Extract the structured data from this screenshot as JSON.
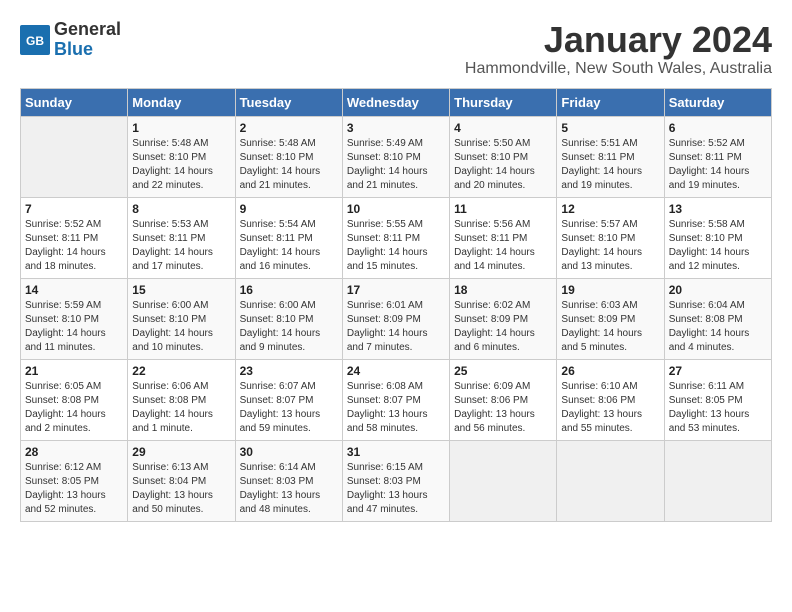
{
  "header": {
    "logo_general": "General",
    "logo_blue": "Blue",
    "title": "January 2024",
    "subtitle": "Hammondville, New South Wales, Australia"
  },
  "days_of_week": [
    "Sunday",
    "Monday",
    "Tuesday",
    "Wednesday",
    "Thursday",
    "Friday",
    "Saturday"
  ],
  "weeks": [
    [
      {
        "day": "",
        "info": ""
      },
      {
        "day": "1",
        "info": "Sunrise: 5:48 AM\nSunset: 8:10 PM\nDaylight: 14 hours\nand 22 minutes."
      },
      {
        "day": "2",
        "info": "Sunrise: 5:48 AM\nSunset: 8:10 PM\nDaylight: 14 hours\nand 21 minutes."
      },
      {
        "day": "3",
        "info": "Sunrise: 5:49 AM\nSunset: 8:10 PM\nDaylight: 14 hours\nand 21 minutes."
      },
      {
        "day": "4",
        "info": "Sunrise: 5:50 AM\nSunset: 8:10 PM\nDaylight: 14 hours\nand 20 minutes."
      },
      {
        "day": "5",
        "info": "Sunrise: 5:51 AM\nSunset: 8:11 PM\nDaylight: 14 hours\nand 19 minutes."
      },
      {
        "day": "6",
        "info": "Sunrise: 5:52 AM\nSunset: 8:11 PM\nDaylight: 14 hours\nand 19 minutes."
      }
    ],
    [
      {
        "day": "7",
        "info": "Sunrise: 5:52 AM\nSunset: 8:11 PM\nDaylight: 14 hours\nand 18 minutes."
      },
      {
        "day": "8",
        "info": "Sunrise: 5:53 AM\nSunset: 8:11 PM\nDaylight: 14 hours\nand 17 minutes."
      },
      {
        "day": "9",
        "info": "Sunrise: 5:54 AM\nSunset: 8:11 PM\nDaylight: 14 hours\nand 16 minutes."
      },
      {
        "day": "10",
        "info": "Sunrise: 5:55 AM\nSunset: 8:11 PM\nDaylight: 14 hours\nand 15 minutes."
      },
      {
        "day": "11",
        "info": "Sunrise: 5:56 AM\nSunset: 8:11 PM\nDaylight: 14 hours\nand 14 minutes."
      },
      {
        "day": "12",
        "info": "Sunrise: 5:57 AM\nSunset: 8:10 PM\nDaylight: 14 hours\nand 13 minutes."
      },
      {
        "day": "13",
        "info": "Sunrise: 5:58 AM\nSunset: 8:10 PM\nDaylight: 14 hours\nand 12 minutes."
      }
    ],
    [
      {
        "day": "14",
        "info": "Sunrise: 5:59 AM\nSunset: 8:10 PM\nDaylight: 14 hours\nand 11 minutes."
      },
      {
        "day": "15",
        "info": "Sunrise: 6:00 AM\nSunset: 8:10 PM\nDaylight: 14 hours\nand 10 minutes."
      },
      {
        "day": "16",
        "info": "Sunrise: 6:00 AM\nSunset: 8:10 PM\nDaylight: 14 hours\nand 9 minutes."
      },
      {
        "day": "17",
        "info": "Sunrise: 6:01 AM\nSunset: 8:09 PM\nDaylight: 14 hours\nand 7 minutes."
      },
      {
        "day": "18",
        "info": "Sunrise: 6:02 AM\nSunset: 8:09 PM\nDaylight: 14 hours\nand 6 minutes."
      },
      {
        "day": "19",
        "info": "Sunrise: 6:03 AM\nSunset: 8:09 PM\nDaylight: 14 hours\nand 5 minutes."
      },
      {
        "day": "20",
        "info": "Sunrise: 6:04 AM\nSunset: 8:08 PM\nDaylight: 14 hours\nand 4 minutes."
      }
    ],
    [
      {
        "day": "21",
        "info": "Sunrise: 6:05 AM\nSunset: 8:08 PM\nDaylight: 14 hours\nand 2 minutes."
      },
      {
        "day": "22",
        "info": "Sunrise: 6:06 AM\nSunset: 8:08 PM\nDaylight: 14 hours\nand 1 minute."
      },
      {
        "day": "23",
        "info": "Sunrise: 6:07 AM\nSunset: 8:07 PM\nDaylight: 13 hours\nand 59 minutes."
      },
      {
        "day": "24",
        "info": "Sunrise: 6:08 AM\nSunset: 8:07 PM\nDaylight: 13 hours\nand 58 minutes."
      },
      {
        "day": "25",
        "info": "Sunrise: 6:09 AM\nSunset: 8:06 PM\nDaylight: 13 hours\nand 56 minutes."
      },
      {
        "day": "26",
        "info": "Sunrise: 6:10 AM\nSunset: 8:06 PM\nDaylight: 13 hours\nand 55 minutes."
      },
      {
        "day": "27",
        "info": "Sunrise: 6:11 AM\nSunset: 8:05 PM\nDaylight: 13 hours\nand 53 minutes."
      }
    ],
    [
      {
        "day": "28",
        "info": "Sunrise: 6:12 AM\nSunset: 8:05 PM\nDaylight: 13 hours\nand 52 minutes."
      },
      {
        "day": "29",
        "info": "Sunrise: 6:13 AM\nSunset: 8:04 PM\nDaylight: 13 hours\nand 50 minutes."
      },
      {
        "day": "30",
        "info": "Sunrise: 6:14 AM\nSunset: 8:03 PM\nDaylight: 13 hours\nand 48 minutes."
      },
      {
        "day": "31",
        "info": "Sunrise: 6:15 AM\nSunset: 8:03 PM\nDaylight: 13 hours\nand 47 minutes."
      },
      {
        "day": "",
        "info": ""
      },
      {
        "day": "",
        "info": ""
      },
      {
        "day": "",
        "info": ""
      }
    ]
  ]
}
